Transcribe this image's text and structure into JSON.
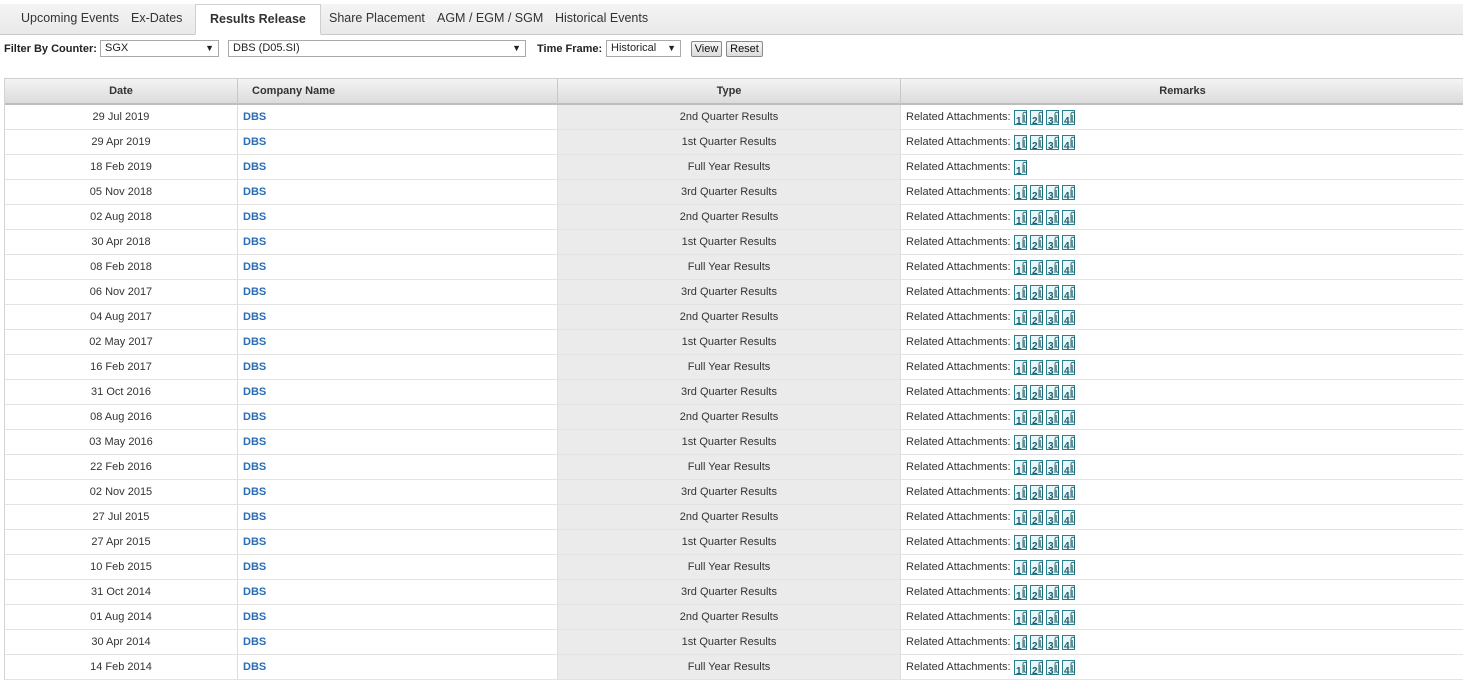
{
  "tabs": [
    {
      "label": "Upcoming Events",
      "active": false
    },
    {
      "label": "Ex-Dates",
      "active": false
    },
    {
      "label": "Results Release",
      "active": true
    },
    {
      "label": "Share Placement",
      "active": false
    },
    {
      "label": "AGM / EGM / SGM",
      "active": false
    },
    {
      "label": "Historical Events",
      "active": false
    }
  ],
  "filters": {
    "counter_label": "Filter By Counter:",
    "exchange_value": "SGX",
    "counter_value": "DBS (D05.SI)",
    "timeframe_label": "Time Frame:",
    "timeframe_value": "Historical",
    "view_label": "View",
    "reset_label": "Reset"
  },
  "table": {
    "headers": {
      "date": "Date",
      "company": "Company Name",
      "type": "Type",
      "remarks": "Remarks"
    },
    "attachments_label": "Related Attachments:",
    "rows": [
      {
        "date": "29 Jul 2019",
        "company": "DBS",
        "type": "2nd Quarter Results",
        "attachments": 4
      },
      {
        "date": "29 Apr 2019",
        "company": "DBS",
        "type": "1st Quarter Results",
        "attachments": 4
      },
      {
        "date": "18 Feb 2019",
        "company": "DBS",
        "type": "Full Year Results",
        "attachments": 1
      },
      {
        "date": "05 Nov 2018",
        "company": "DBS",
        "type": "3rd Quarter Results",
        "attachments": 4
      },
      {
        "date": "02 Aug 2018",
        "company": "DBS",
        "type": "2nd Quarter Results",
        "attachments": 4
      },
      {
        "date": "30 Apr 2018",
        "company": "DBS",
        "type": "1st Quarter Results",
        "attachments": 4
      },
      {
        "date": "08 Feb 2018",
        "company": "DBS",
        "type": "Full Year Results",
        "attachments": 4
      },
      {
        "date": "06 Nov 2017",
        "company": "DBS",
        "type": "3rd Quarter Results",
        "attachments": 4
      },
      {
        "date": "04 Aug 2017",
        "company": "DBS",
        "type": "2nd Quarter Results",
        "attachments": 4
      },
      {
        "date": "02 May 2017",
        "company": "DBS",
        "type": "1st Quarter Results",
        "attachments": 4
      },
      {
        "date": "16 Feb 2017",
        "company": "DBS",
        "type": "Full Year Results",
        "attachments": 4
      },
      {
        "date": "31 Oct 2016",
        "company": "DBS",
        "type": "3rd Quarter Results",
        "attachments": 4
      },
      {
        "date": "08 Aug 2016",
        "company": "DBS",
        "type": "2nd Quarter Results",
        "attachments": 4
      },
      {
        "date": "03 May 2016",
        "company": "DBS",
        "type": "1st Quarter Results",
        "attachments": 4
      },
      {
        "date": "22 Feb 2016",
        "company": "DBS",
        "type": "Full Year Results",
        "attachments": 4
      },
      {
        "date": "02 Nov 2015",
        "company": "DBS",
        "type": "3rd Quarter Results",
        "attachments": 4
      },
      {
        "date": "27 Jul 2015",
        "company": "DBS",
        "type": "2nd Quarter Results",
        "attachments": 4
      },
      {
        "date": "27 Apr 2015",
        "company": "DBS",
        "type": "1st Quarter Results",
        "attachments": 4
      },
      {
        "date": "10 Feb 2015",
        "company": "DBS",
        "type": "Full Year Results",
        "attachments": 4
      },
      {
        "date": "31 Oct 2014",
        "company": "DBS",
        "type": "3rd Quarter Results",
        "attachments": 4
      },
      {
        "date": "01 Aug 2014",
        "company": "DBS",
        "type": "2nd Quarter Results",
        "attachments": 4
      },
      {
        "date": "30 Apr 2014",
        "company": "DBS",
        "type": "1st Quarter Results",
        "attachments": 4
      },
      {
        "date": "14 Feb 2014",
        "company": "DBS",
        "type": "Full Year Results",
        "attachments": 4
      }
    ]
  }
}
